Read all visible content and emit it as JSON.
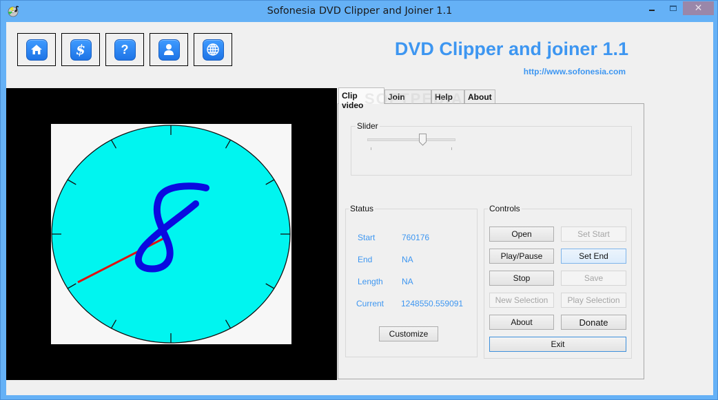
{
  "window": {
    "title": "Sofonesia DVD Clipper and Joiner 1.1",
    "app_icon": "dvd-music-icon",
    "controls": {
      "minimize": "minimize-icon",
      "maximize": "maximize-icon",
      "close_glyph": "✕"
    }
  },
  "toolbar": {
    "buttons": [
      {
        "name": "home",
        "icon": "home-icon"
      },
      {
        "name": "donate",
        "icon": "dollar-icon",
        "glyph": "$"
      },
      {
        "name": "help",
        "icon": "question-icon",
        "glyph": "?"
      },
      {
        "name": "user",
        "icon": "user-icon"
      },
      {
        "name": "website",
        "icon": "globe-icon"
      }
    ]
  },
  "brand": {
    "title": "DVD Clipper and joiner 1.1",
    "url": "http://www.sofonesia.com",
    "color": "#3d96f1"
  },
  "video": {
    "frame_description": "clock face with digit 8",
    "digit": "8",
    "face_color": "#00f5f0",
    "digit_color": "#0a0ae0",
    "hand_color": "#e01010"
  },
  "tabs": [
    {
      "label": "Clip video",
      "active": true
    },
    {
      "label": "Join video",
      "active": false
    },
    {
      "label": "Help",
      "active": false
    },
    {
      "label": "About",
      "active": false
    }
  ],
  "watermark": "SOFTPEDIA",
  "clip": {
    "slider": {
      "label": "Slider",
      "value_fraction": 0.64
    },
    "status": {
      "label": "Status",
      "rows": [
        {
          "label": "Start",
          "value": "760176"
        },
        {
          "label": "End",
          "value": "NA"
        },
        {
          "label": "Length",
          "value": "NA"
        },
        {
          "label": "Current",
          "value": "1248550.559091"
        }
      ],
      "customize_label": "Customize"
    },
    "controls": {
      "label": "Controls",
      "buttons": [
        {
          "label": "Open",
          "enabled": true
        },
        {
          "label": "Set Start",
          "enabled": false
        },
        {
          "label": "Play/Pause",
          "enabled": true
        },
        {
          "label": "Set End",
          "enabled": true,
          "hovered": true
        },
        {
          "label": "Stop",
          "enabled": true
        },
        {
          "label": "Save",
          "enabled": false
        },
        {
          "label": "New Selection",
          "enabled": false
        },
        {
          "label": "Play Selection",
          "enabled": false
        },
        {
          "label": "About",
          "enabled": true
        },
        {
          "label": "Donate",
          "enabled": true
        }
      ],
      "exit_label": "Exit"
    }
  }
}
